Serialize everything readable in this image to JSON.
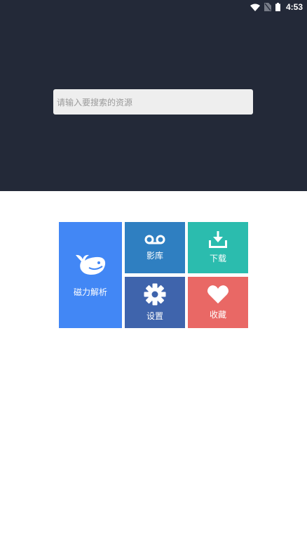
{
  "status_bar": {
    "time": "4:53",
    "icons": [
      "wifi-icon",
      "no-sim-icon",
      "battery-icon"
    ]
  },
  "search": {
    "placeholder": "请输入要搜索的资源"
  },
  "tiles": {
    "magnet": {
      "label": "磁力解析",
      "icon": "whale-icon",
      "color": "#4287f5"
    },
    "library": {
      "label": "影库",
      "icon": "voicemail-icon",
      "color": "#2f7fc1"
    },
    "download": {
      "label": "下载",
      "icon": "download-icon",
      "color": "#2bbcae"
    },
    "settings": {
      "label": "设置",
      "icon": "gear-icon",
      "color": "#3f64ac"
    },
    "favorites": {
      "label": "收藏",
      "icon": "heart-icon",
      "color": "#e96865"
    }
  },
  "colors": {
    "header_bg": "#232938",
    "search_bg": "#eeeeee",
    "page_bg": "#ffffff"
  }
}
